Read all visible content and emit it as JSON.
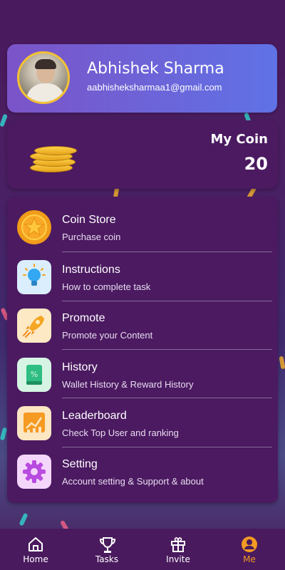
{
  "profile": {
    "name": "Abhishek Sharma",
    "email": "aabhisheksharmaa1@gmail.com"
  },
  "coin": {
    "title": "My Coin",
    "value": "20"
  },
  "menu": [
    {
      "title": "Coin Store",
      "subtitle": "Purchase coin",
      "icon": "star-coin-icon"
    },
    {
      "title": "Instructions",
      "subtitle": "How to complete task",
      "icon": "lightbulb-icon"
    },
    {
      "title": "Promote",
      "subtitle": "Promote your Content",
      "icon": "rocket-icon"
    },
    {
      "title": "History",
      "subtitle": "Wallet History & Reward History",
      "icon": "history-book-icon"
    },
    {
      "title": "Leaderboard",
      "subtitle": "Check Top User and ranking",
      "icon": "leaderboard-chart-icon"
    },
    {
      "title": "Setting",
      "subtitle": "Account setting & Support & about",
      "icon": "gear-icon"
    }
  ],
  "nav": [
    {
      "label": "Home",
      "icon": "home-icon"
    },
    {
      "label": "Tasks",
      "icon": "trophy-icon"
    },
    {
      "label": "Invite",
      "icon": "gift-icon"
    },
    {
      "label": "Me",
      "icon": "user-icon",
      "active": true
    }
  ],
  "colors": {
    "background": "#4a1a5e",
    "card": "#4b1a61",
    "profile_gradient_start": "#7b54c8",
    "profile_gradient_end": "#5f72e6",
    "active_nav": "#f19a22",
    "avatar_ring": "#f3c234"
  }
}
